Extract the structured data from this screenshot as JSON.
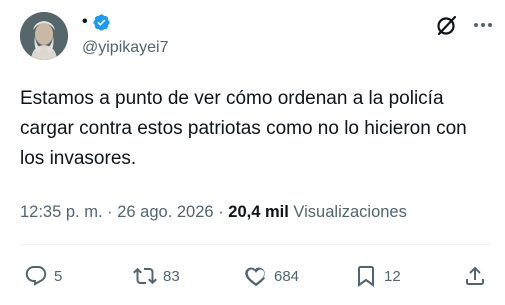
{
  "author": {
    "display_name": "•",
    "handle": "@yipikayei7",
    "verified": true,
    "verified_color": "#1d9bf0"
  },
  "header": {
    "grok_icon": "grok-slash-circle-icon",
    "more_icon": "more-horizontal-icon"
  },
  "tweet": {
    "text": "Estamos a punto de ver cómo ordenan a la policía cargar contra estos patriotas como no lo hicieron con los invasores."
  },
  "meta": {
    "time": "12:35 p. m.",
    "separator": "·",
    "date": "26 ago. 2026",
    "separator2": "·",
    "views_count": "20,4 mil",
    "views_label": "Visualizaciones"
  },
  "actions": {
    "reply_count": "5",
    "retweet_count": "83",
    "like_count": "684",
    "bookmark_count": "12"
  },
  "colors": {
    "text_primary": "#0f1419",
    "text_secondary": "#536471",
    "accent": "#1d9bf0",
    "divider": "#eff3f4"
  }
}
